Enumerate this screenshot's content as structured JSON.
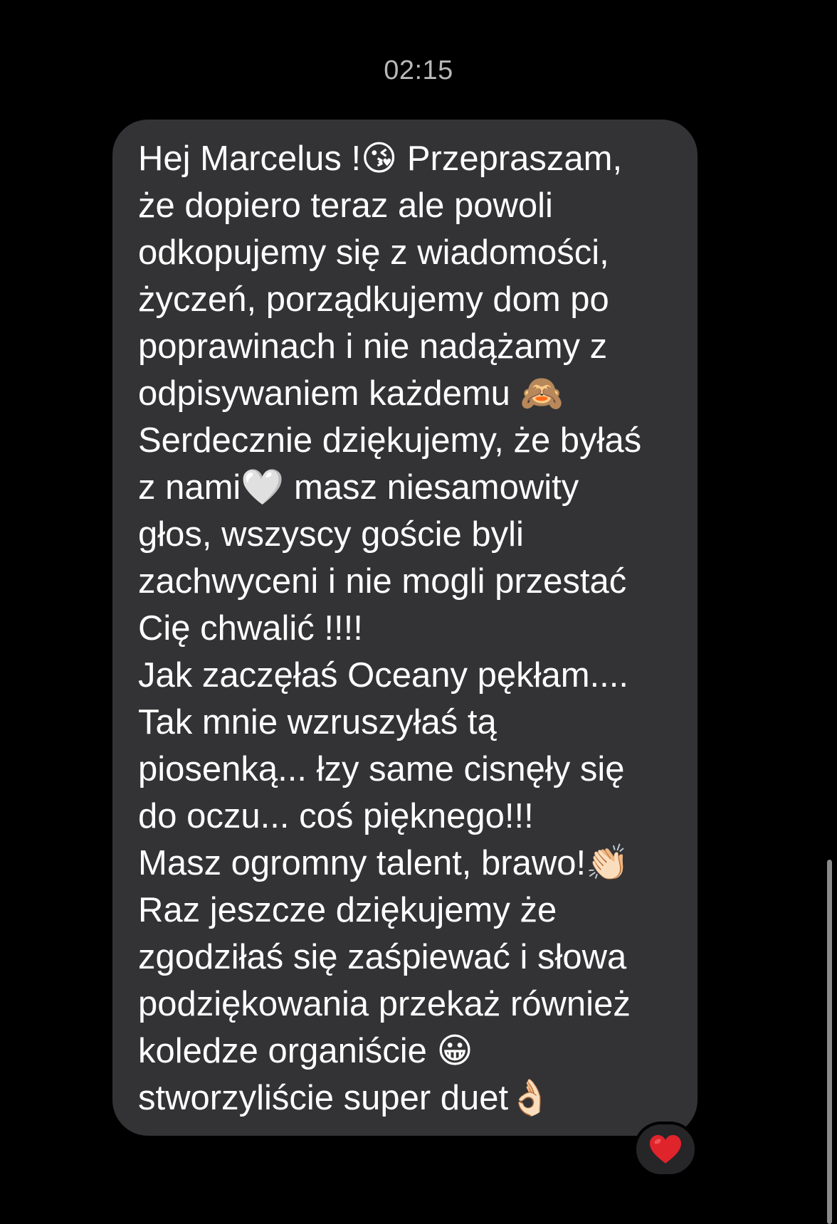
{
  "conversation": {
    "timestamp": "02:15",
    "message": {
      "lines": [
        "Hej Marcelus !😘 Przepraszam,",
        "że dopiero teraz ale powoli",
        "odkopujemy się z wiadomości,",
        "życzeń, porządkujemy dom po",
        "poprawinach i nie nadążamy z",
        "odpisywaniem każdemu 🙈",
        "Serdecznie dziękujemy, że byłaś",
        "z nami🤍 masz niesamowity",
        "głos, wszyscy goście byli",
        "zachwyceni i nie mogli przestać",
        "Cię chwalić !!!!",
        "Jak zaczęłaś Oceany pękłam....",
        "Tak mnie wzruszyłaś tą",
        "piosenką... łzy same cisnęły się",
        "do oczu... coś pięknego!!!",
        "Masz ogromny talent, brawo!👏🏻",
        "Raz jeszcze dziękujemy że",
        "zgodziłaś się zaśpiewać i słowa",
        "podziękowania przekaż również",
        "koledze organiście 😀",
        "stworzyliście super duet👌🏻"
      ],
      "reaction": {
        "icon": "red-heart-icon",
        "color": "#e0242b"
      }
    }
  }
}
